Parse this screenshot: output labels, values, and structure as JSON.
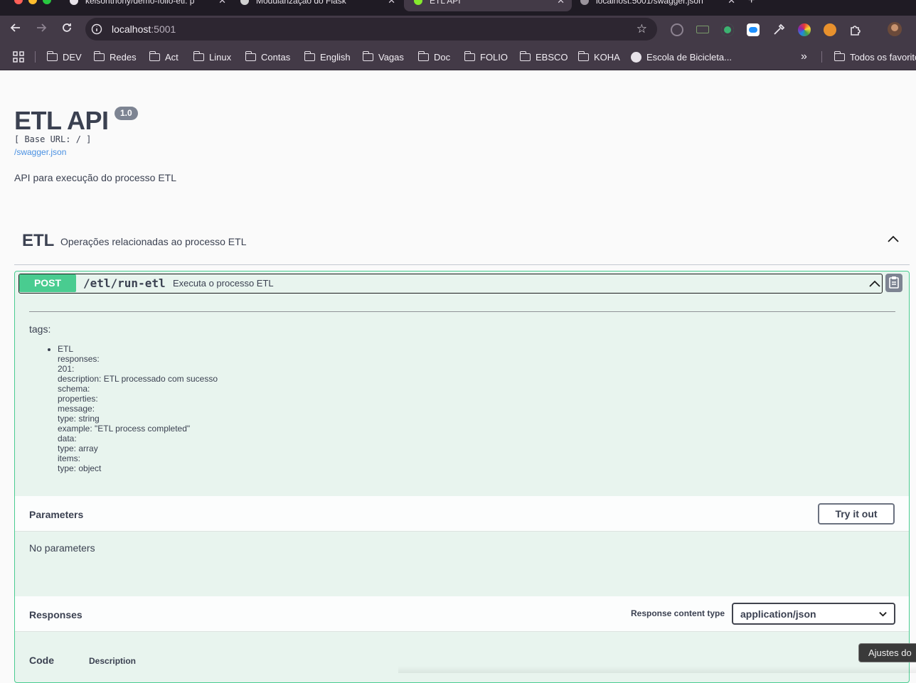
{
  "browser": {
    "tabs": [
      {
        "label": "kelsonthony/demo-folio-etl: p",
        "active": false
      },
      {
        "label": "Modularização do Flask",
        "active": false
      },
      {
        "label": "ETL API",
        "active": true
      },
      {
        "label": "localhost:5001/swagger.json",
        "active": false
      }
    ],
    "new_tab": "+",
    "url_host": "localhost",
    "url_port": ":5001",
    "bookmarks": [
      "DEV",
      "Redes",
      "Act",
      "Linux",
      "Contas",
      "English",
      "Vagas",
      "Doc",
      "FOLIO",
      "EBSCO",
      "KOHA",
      "Escola de Bicicleta...",
      "Todos os favoritos"
    ],
    "overflow": "»",
    "colors": {
      "chrome": "#433a47",
      "omnibox": "#2d2631",
      "tabstrip": "#1f1b24"
    }
  },
  "info": {
    "title": "ETL API",
    "version": "1.0",
    "base_url": "[ Base URL: / ]",
    "spec_link": "/swagger.json",
    "description": "API para execução do processo ETL"
  },
  "tag": {
    "name": "ETL",
    "description": "Operações relacionadas ao processo ETL"
  },
  "operation": {
    "method": "POST",
    "path": "/etl/run-etl",
    "summary": "Executa o processo ETL",
    "tags_label": "tags:",
    "doc_lines": [
      "ETL",
      "responses:",
      "201:",
      "description: ETL processado com sucesso",
      "schema:",
      "properties:",
      "message:",
      "type: string",
      "example: \"ETL process completed\"",
      "data:",
      "type: array",
      "items:",
      "type: object"
    ],
    "method_color": "#49cc90"
  },
  "parameters": {
    "title": "Parameters",
    "try_button": "Try it out",
    "empty": "No parameters"
  },
  "responses": {
    "title": "Responses",
    "content_type_label": "Response content type",
    "content_type_value": "application/json",
    "col_code": "Code",
    "col_description": "Description"
  },
  "tooltip": "Ajustes do"
}
